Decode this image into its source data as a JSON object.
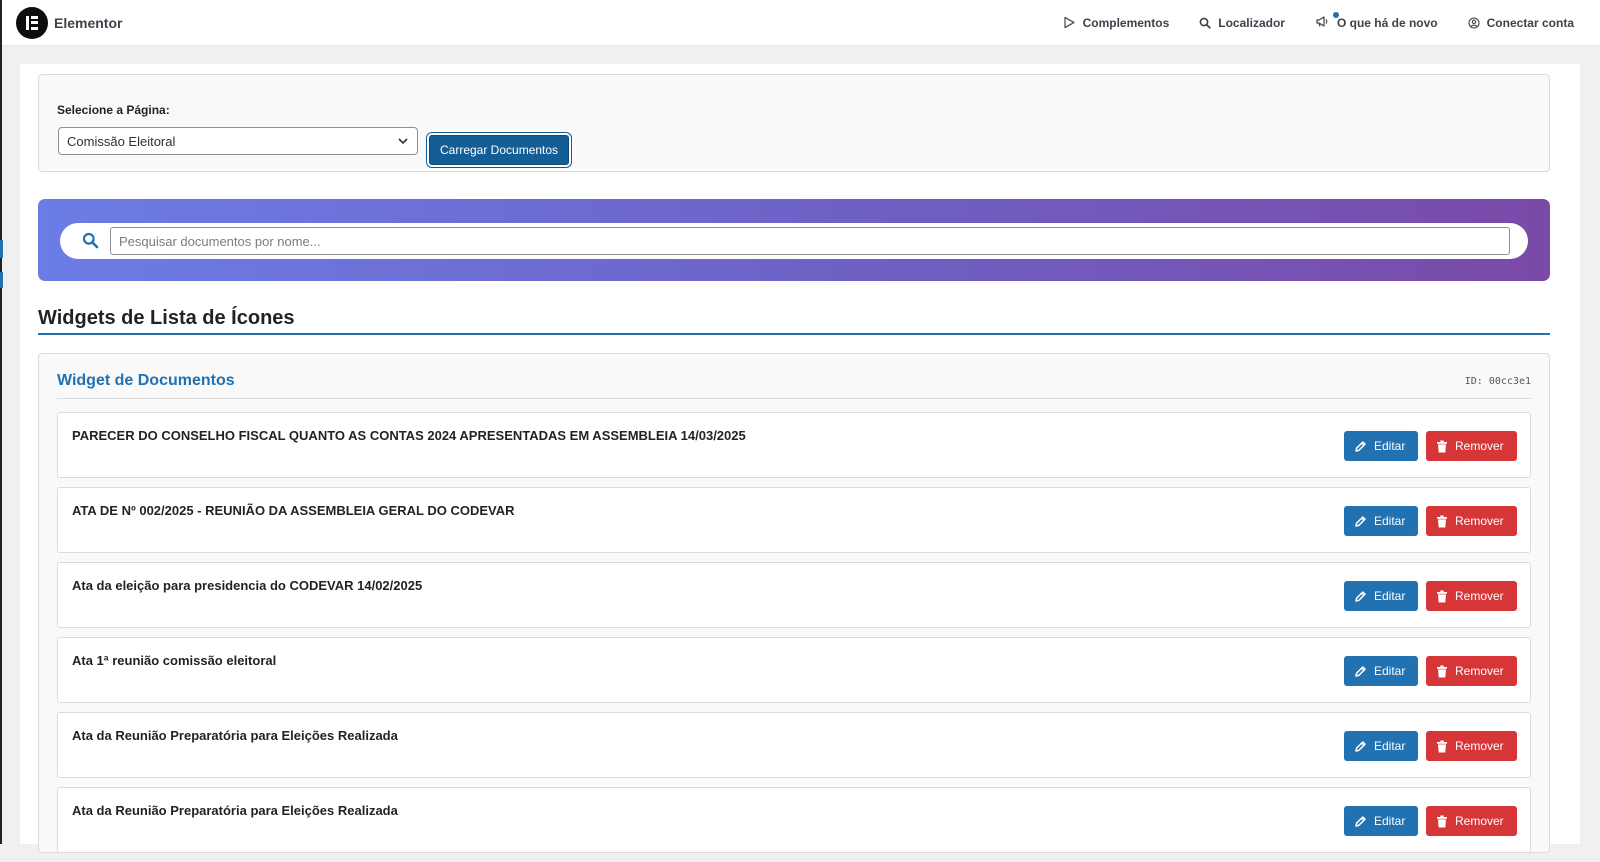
{
  "topbar": {
    "brand": "Elementor",
    "nav": [
      {
        "label": "Complementos",
        "icon": "play-outline-icon"
      },
      {
        "label": "Localizador",
        "icon": "search-icon"
      },
      {
        "label": "O que há de novo",
        "icon": "megaphone-icon"
      },
      {
        "label": "Conectar conta",
        "icon": "user-circle-icon"
      }
    ]
  },
  "selector": {
    "label": "Selecione a Página:",
    "selected": "Comissão Eleitoral",
    "button": "Carregar Documentos"
  },
  "search": {
    "placeholder": "Pesquisar documentos por nome..."
  },
  "section": {
    "title": "Widgets de Lista de Ícones"
  },
  "widget": {
    "title": "Widget de Documentos",
    "id": "ID: 00cc3e1",
    "edit_label": "Editar",
    "remove_label": "Remover",
    "documents": [
      {
        "title": "PARECER DO CONSELHO FISCAL QUANTO AS CONTAS 2024 APRESENTADAS EM ASSEMBLEIA 14/03/2025",
        "url": ""
      },
      {
        "title": "ATA DE Nº 002/2025 - REUNIÃO DA ASSEMBLEIA GERAL DO CODEVAR",
        "url": ""
      },
      {
        "title": "Ata da eleição para presidencia do CODEVAR 14/02/2025",
        "url": ""
      },
      {
        "title": "Ata 1ª reunião comissão eleitoral",
        "url": ""
      },
      {
        "title": "Ata da Reunião Preparatória para Eleições Realizada",
        "url": ""
      },
      {
        "title": "Ata da Reunião Preparatória para Eleições Realizada",
        "url": ""
      }
    ]
  },
  "colors": {
    "primary": "#2271b1",
    "danger": "#d63638",
    "banner_start": "#6c7de6",
    "banner_end": "#7a4aa8"
  }
}
